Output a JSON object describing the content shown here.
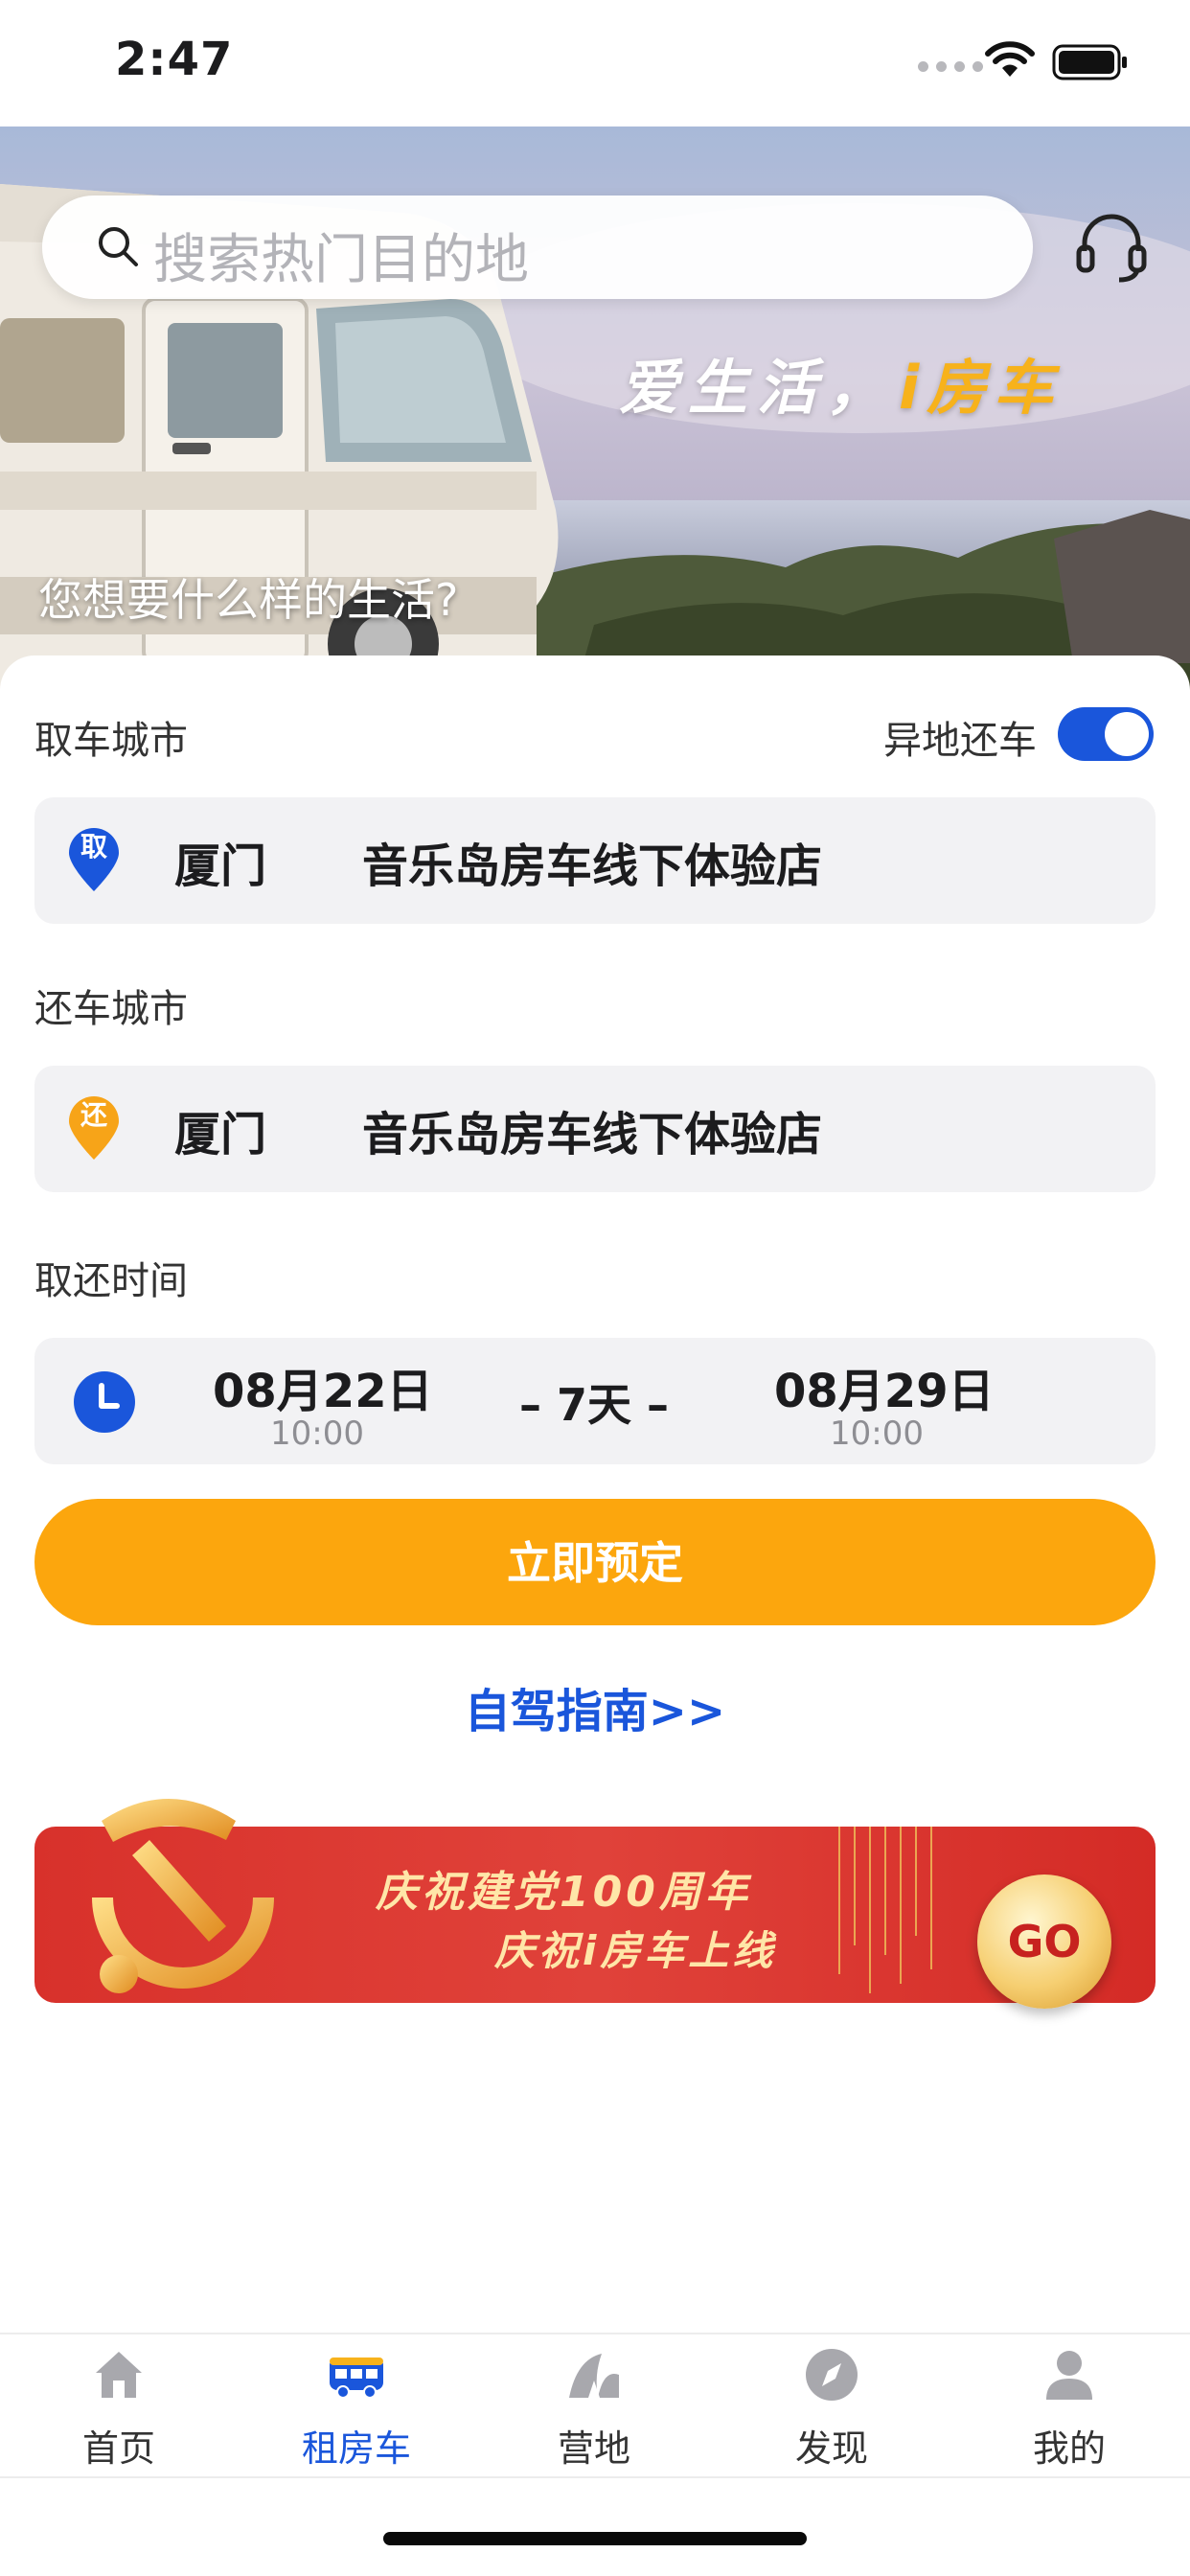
{
  "status_bar": {
    "time": "2:47"
  },
  "header": {
    "search_placeholder": "搜索热门目的地",
    "slogan_main": "爱生活，",
    "slogan_accent": "i房车",
    "caption": "您想要什么样的生活?"
  },
  "booking": {
    "pickup_city_label": "取车城市",
    "different_return_label": "异地还车",
    "different_return_enabled": true,
    "pickup": {
      "badge": "取",
      "city": "厦门",
      "store": "音乐岛房车线下体验店"
    },
    "return_city_label": "还车城市",
    "return": {
      "badge": "还",
      "city": "厦门",
      "store": "音乐岛房车线下体验店"
    },
    "time_label": "取还时间",
    "start_date": "08月22日",
    "start_time": "10:00",
    "duration": "– 7天 –",
    "end_date": "08月29日",
    "end_time": "10:00",
    "book_button": "立即预定",
    "guide_link": "自驾指南>>"
  },
  "promo": {
    "line1": "庆祝建党100周年",
    "line2": "庆祝i房车上线",
    "go_label": "GO"
  },
  "tabs": [
    {
      "label": "首页",
      "icon": "home-icon",
      "active": false
    },
    {
      "label": "租房车",
      "icon": "rv-icon",
      "active": true
    },
    {
      "label": "营地",
      "icon": "camp-icon",
      "active": false
    },
    {
      "label": "发现",
      "icon": "compass-icon",
      "active": false
    },
    {
      "label": "我的",
      "icon": "user-icon",
      "active": false
    }
  ],
  "colors": {
    "accent_blue": "#1a56db",
    "button_orange": "#fca60d",
    "slogan_yellow": "#f7b21b",
    "pickup_pin": "#1a56db",
    "return_pin": "#f7a418"
  }
}
